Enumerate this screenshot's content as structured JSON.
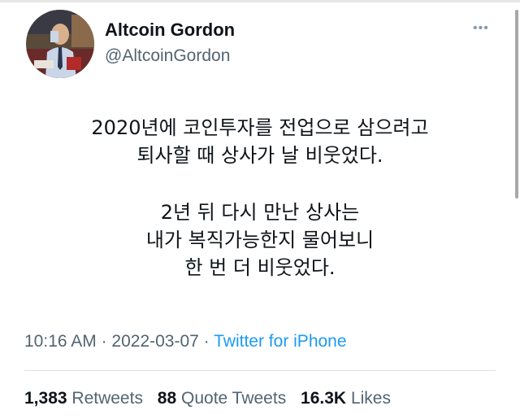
{
  "author": {
    "display_name": "Altcoin Gordon",
    "handle": "@AltcoinGordon"
  },
  "more_icon": "more-horizontal-icon",
  "tweet": {
    "paragraph1": [
      "2020년에 코인투자를 전업으로 삼으려고",
      "퇴사할 때 상사가 날 비웃었다."
    ],
    "paragraph2": [
      "2년 뒤 다시 만난 상사는",
      "내가 복직가능한지 물어보니",
      "한 번 더 비웃었다."
    ]
  },
  "meta": {
    "time": "10:16 AM",
    "separator": " · ",
    "date": "2022-03-07",
    "source": "Twitter for iPhone"
  },
  "stats": {
    "retweets_count": "1,383",
    "retweets_label": "Retweets",
    "quotes_count": "88",
    "quotes_label": "Quote Tweets",
    "likes_count": "16.3K",
    "likes_label": "Likes"
  },
  "colors": {
    "link": "#1d9bf0",
    "secondary_text": "#536471",
    "primary_text": "#0f1419"
  }
}
